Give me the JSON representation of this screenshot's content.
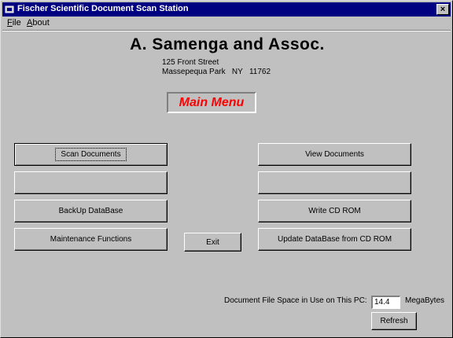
{
  "window": {
    "title": "Fischer Scientific Document Scan Station",
    "close_glyph": "×"
  },
  "menubar": {
    "file": {
      "accel": "F",
      "rest": "ile"
    },
    "about": {
      "accel": "A",
      "rest": "bout"
    }
  },
  "header": {
    "company": "A. Samenga and Assoc.",
    "address_line1": "125 Front Street",
    "address_line2": "Massepequa Park   NY   11762"
  },
  "main_menu_label": "Main Menu",
  "buttons": {
    "scan": "Scan Documents",
    "blank_left": "",
    "backup": "BackUp DataBase",
    "maintenance": "Maintenance Functions",
    "view": "View Documents",
    "blank_right": "",
    "write_cd": "Write CD ROM",
    "update_db": "Update DataBase from CD ROM",
    "exit": "Exit",
    "refresh": "Refresh"
  },
  "status": {
    "space_label": "Document  File Space in Use on This PC:",
    "space_value": "14.4",
    "units": "MegaBytes"
  },
  "icons": {
    "app": "app-icon",
    "close": "close-icon"
  }
}
